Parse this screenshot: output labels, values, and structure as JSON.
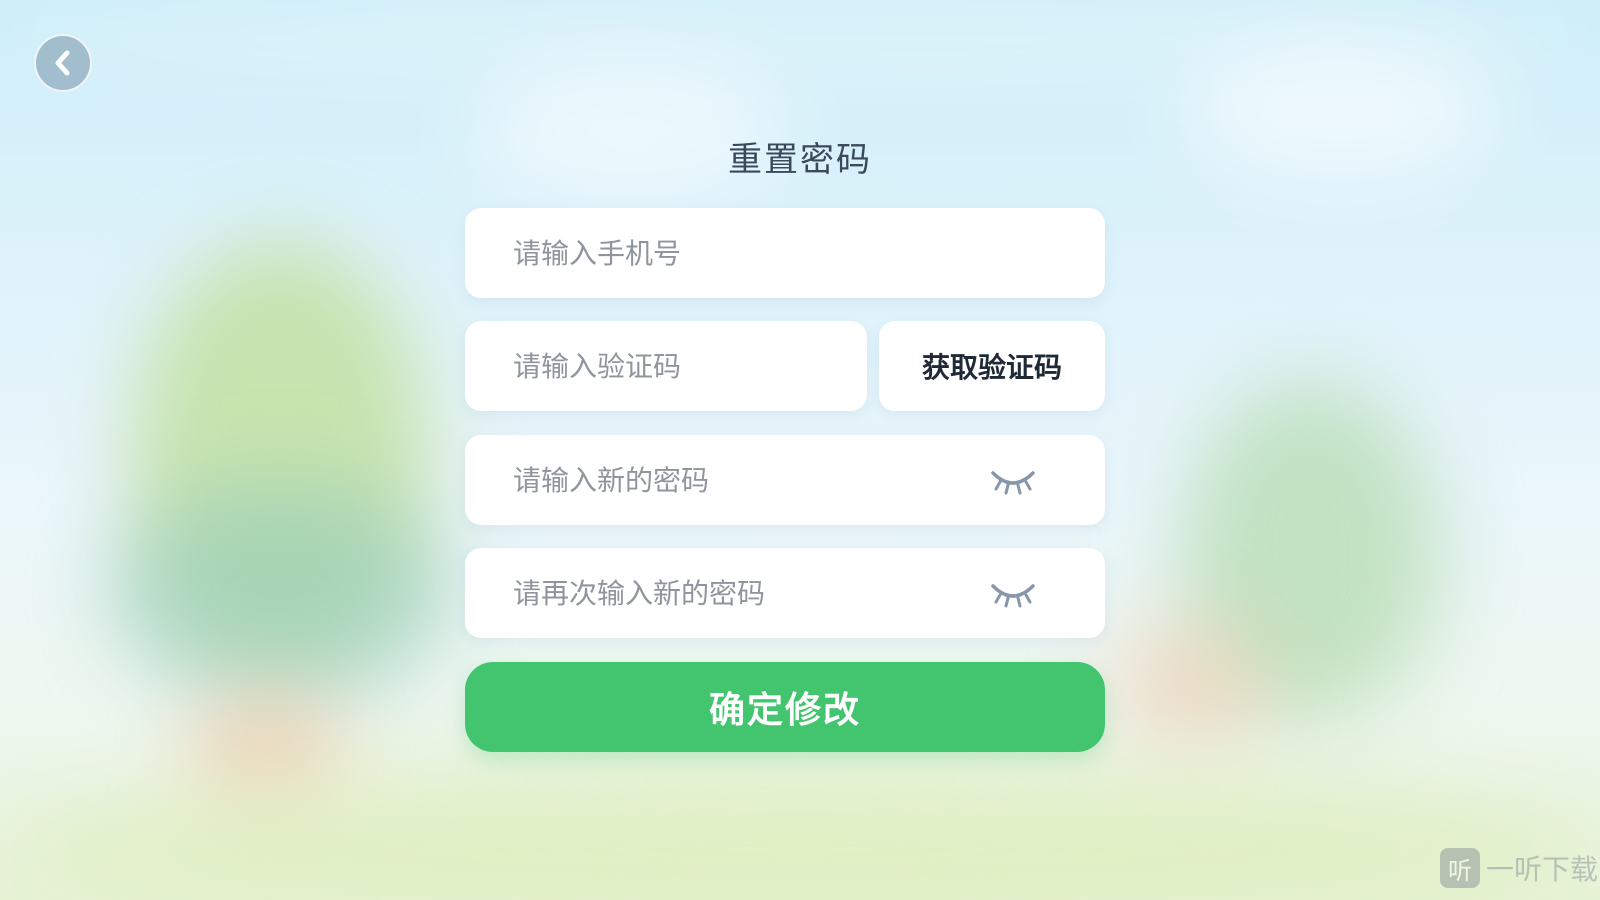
{
  "header": {
    "back_icon": "chevron-left-icon",
    "title": "重置密码"
  },
  "form": {
    "phone_placeholder": "请输入手机号",
    "code_placeholder": "请输入验证码",
    "get_code_label": "获取验证码",
    "new_password_placeholder": "请输入新的密码",
    "confirm_password_placeholder": "请再次输入新的密码",
    "password_toggle_icon": "eye-closed-icon",
    "submit_label": "确定修改"
  },
  "watermark": {
    "logo_char": "听",
    "text": "一听下载"
  },
  "colors": {
    "accent_green": "#42c56e",
    "title_text": "#3a4a5c",
    "placeholder_text": "#8f959c",
    "eye_icon": "#8796aa"
  }
}
